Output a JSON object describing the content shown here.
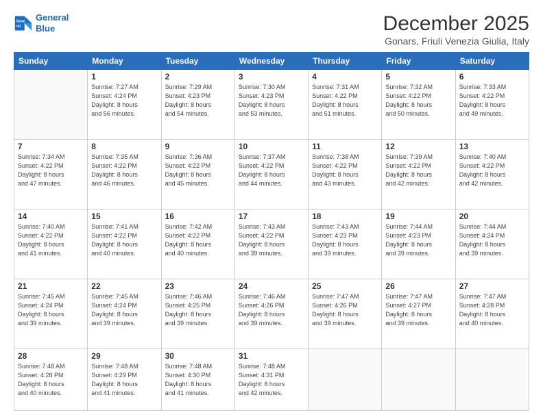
{
  "header": {
    "logo_line1": "General",
    "logo_line2": "Blue",
    "month_title": "December 2025",
    "location": "Gonars, Friuli Venezia Giulia, Italy"
  },
  "days_of_week": [
    "Sunday",
    "Monday",
    "Tuesday",
    "Wednesday",
    "Thursday",
    "Friday",
    "Saturday"
  ],
  "weeks": [
    [
      {
        "day": "",
        "info": ""
      },
      {
        "day": "1",
        "info": "Sunrise: 7:27 AM\nSunset: 4:24 PM\nDaylight: 8 hours\nand 56 minutes."
      },
      {
        "day": "2",
        "info": "Sunrise: 7:29 AM\nSunset: 4:23 PM\nDaylight: 8 hours\nand 54 minutes."
      },
      {
        "day": "3",
        "info": "Sunrise: 7:30 AM\nSunset: 4:23 PM\nDaylight: 8 hours\nand 53 minutes."
      },
      {
        "day": "4",
        "info": "Sunrise: 7:31 AM\nSunset: 4:22 PM\nDaylight: 8 hours\nand 51 minutes."
      },
      {
        "day": "5",
        "info": "Sunrise: 7:32 AM\nSunset: 4:22 PM\nDaylight: 8 hours\nand 50 minutes."
      },
      {
        "day": "6",
        "info": "Sunrise: 7:33 AM\nSunset: 4:22 PM\nDaylight: 8 hours\nand 49 minutes."
      }
    ],
    [
      {
        "day": "7",
        "info": "Sunrise: 7:34 AM\nSunset: 4:22 PM\nDaylight: 8 hours\nand 47 minutes."
      },
      {
        "day": "8",
        "info": "Sunrise: 7:35 AM\nSunset: 4:22 PM\nDaylight: 8 hours\nand 46 minutes."
      },
      {
        "day": "9",
        "info": "Sunrise: 7:36 AM\nSunset: 4:22 PM\nDaylight: 8 hours\nand 45 minutes."
      },
      {
        "day": "10",
        "info": "Sunrise: 7:37 AM\nSunset: 4:22 PM\nDaylight: 8 hours\nand 44 minutes."
      },
      {
        "day": "11",
        "info": "Sunrise: 7:38 AM\nSunset: 4:22 PM\nDaylight: 8 hours\nand 43 minutes."
      },
      {
        "day": "12",
        "info": "Sunrise: 7:39 AM\nSunset: 4:22 PM\nDaylight: 8 hours\nand 42 minutes."
      },
      {
        "day": "13",
        "info": "Sunrise: 7:40 AM\nSunset: 4:22 PM\nDaylight: 8 hours\nand 42 minutes."
      }
    ],
    [
      {
        "day": "14",
        "info": "Sunrise: 7:40 AM\nSunset: 4:22 PM\nDaylight: 8 hours\nand 41 minutes."
      },
      {
        "day": "15",
        "info": "Sunrise: 7:41 AM\nSunset: 4:22 PM\nDaylight: 8 hours\nand 40 minutes."
      },
      {
        "day": "16",
        "info": "Sunrise: 7:42 AM\nSunset: 4:22 PM\nDaylight: 8 hours\nand 40 minutes."
      },
      {
        "day": "17",
        "info": "Sunrise: 7:43 AM\nSunset: 4:22 PM\nDaylight: 8 hours\nand 39 minutes."
      },
      {
        "day": "18",
        "info": "Sunrise: 7:43 AM\nSunset: 4:23 PM\nDaylight: 8 hours\nand 39 minutes."
      },
      {
        "day": "19",
        "info": "Sunrise: 7:44 AM\nSunset: 4:23 PM\nDaylight: 8 hours\nand 39 minutes."
      },
      {
        "day": "20",
        "info": "Sunrise: 7:44 AM\nSunset: 4:24 PM\nDaylight: 8 hours\nand 39 minutes."
      }
    ],
    [
      {
        "day": "21",
        "info": "Sunrise: 7:45 AM\nSunset: 4:24 PM\nDaylight: 8 hours\nand 39 minutes."
      },
      {
        "day": "22",
        "info": "Sunrise: 7:45 AM\nSunset: 4:24 PM\nDaylight: 8 hours\nand 39 minutes."
      },
      {
        "day": "23",
        "info": "Sunrise: 7:46 AM\nSunset: 4:25 PM\nDaylight: 8 hours\nand 39 minutes."
      },
      {
        "day": "24",
        "info": "Sunrise: 7:46 AM\nSunset: 4:26 PM\nDaylight: 8 hours\nand 39 minutes."
      },
      {
        "day": "25",
        "info": "Sunrise: 7:47 AM\nSunset: 4:26 PM\nDaylight: 8 hours\nand 39 minutes."
      },
      {
        "day": "26",
        "info": "Sunrise: 7:47 AM\nSunset: 4:27 PM\nDaylight: 8 hours\nand 39 minutes."
      },
      {
        "day": "27",
        "info": "Sunrise: 7:47 AM\nSunset: 4:28 PM\nDaylight: 8 hours\nand 40 minutes."
      }
    ],
    [
      {
        "day": "28",
        "info": "Sunrise: 7:48 AM\nSunset: 4:28 PM\nDaylight: 8 hours\nand 40 minutes."
      },
      {
        "day": "29",
        "info": "Sunrise: 7:48 AM\nSunset: 4:29 PM\nDaylight: 8 hours\nand 41 minutes."
      },
      {
        "day": "30",
        "info": "Sunrise: 7:48 AM\nSunset: 4:30 PM\nDaylight: 8 hours\nand 41 minutes."
      },
      {
        "day": "31",
        "info": "Sunrise: 7:48 AM\nSunset: 4:31 PM\nDaylight: 8 hours\nand 42 minutes."
      },
      {
        "day": "",
        "info": ""
      },
      {
        "day": "",
        "info": ""
      },
      {
        "day": "",
        "info": ""
      }
    ]
  ]
}
